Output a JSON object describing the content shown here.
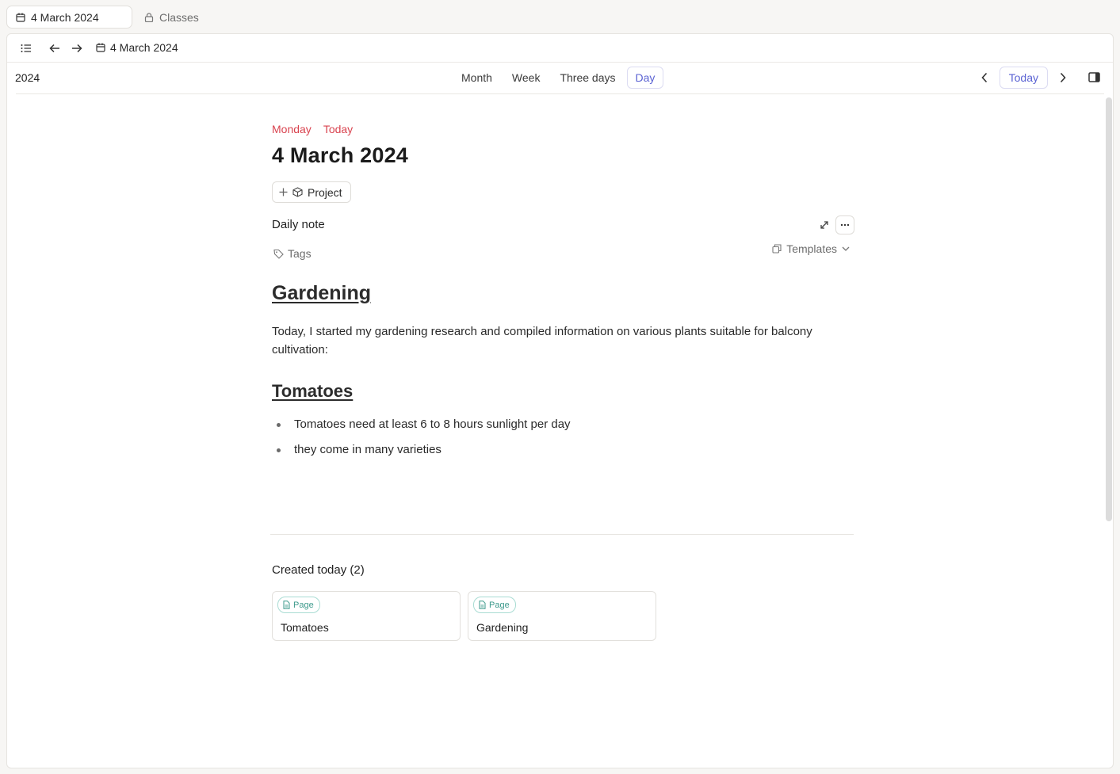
{
  "tabs": [
    {
      "label": "4 March 2024",
      "icon": "calendar-icon",
      "active": true
    },
    {
      "label": "Classes",
      "icon": "lock-icon",
      "active": false
    }
  ],
  "toolbar": {
    "title": "4 March 2024",
    "icons": [
      "list-icon",
      "arrow-left-icon",
      "arrow-right-icon",
      "calendar-icon"
    ]
  },
  "calendar": {
    "year": "2024",
    "views": [
      "Month",
      "Week",
      "Three days",
      "Day"
    ],
    "selected_view": "Day",
    "today_label": "Today"
  },
  "day": {
    "weekday": "Monday",
    "relative": "Today",
    "title": "4 March 2024",
    "project_label": "Project"
  },
  "note": {
    "title": "Daily note",
    "tags_label": "Tags",
    "templates_label": "Templates",
    "heading1": "Gardening",
    "paragraph": "Today, I started my gardening research and compiled information on various plants suitable for balcony cultivation:",
    "heading2": "Tomatoes",
    "bullets": [
      "Tomatoes need at least 6 to 8 hours sunlight per day",
      "they come in many varieties"
    ]
  },
  "created_today": {
    "label": "Created today (2)",
    "cards": [
      {
        "badge": "Page",
        "title": "Tomatoes"
      },
      {
        "badge": "Page",
        "title": "Gardening"
      }
    ]
  },
  "colors": {
    "accent": "#5b63d3",
    "today_red": "#d9434f",
    "badge_teal": "#3d9a8c"
  }
}
